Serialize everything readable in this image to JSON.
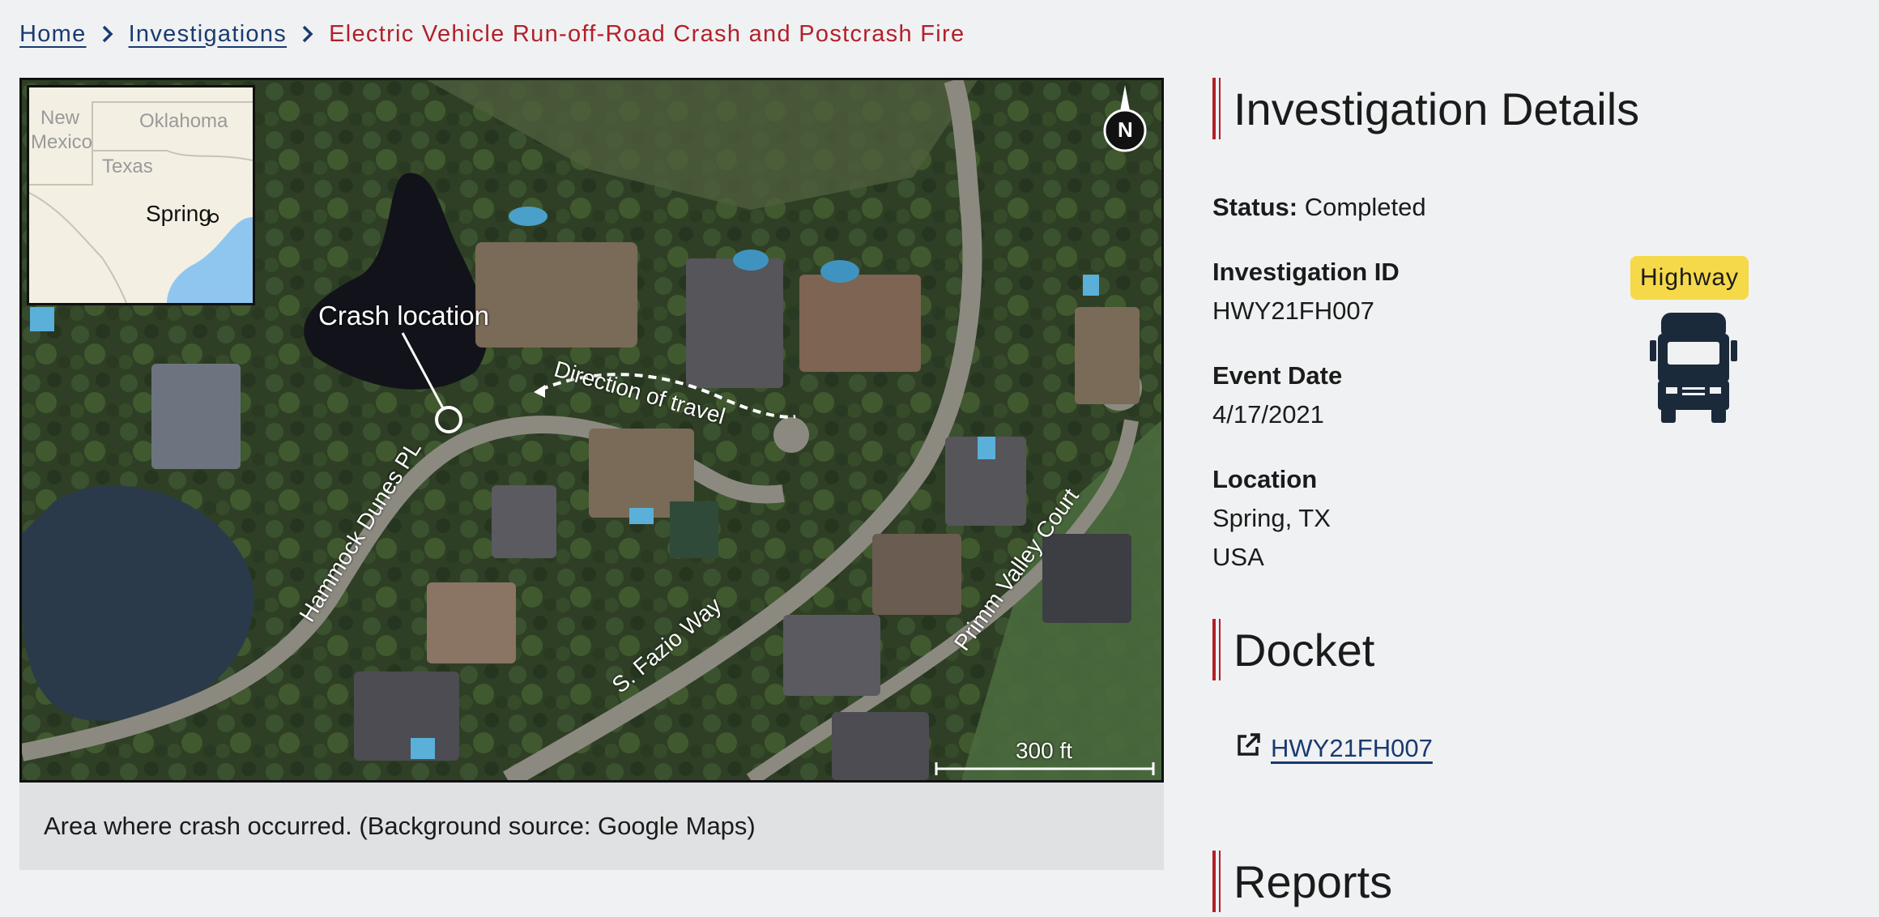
{
  "breadcrumb": {
    "home": "Home",
    "investigations": "Investigations",
    "current": "Electric Vehicle Run-off-Road Crash and Postcrash Fire"
  },
  "figure": {
    "caption": "Area where crash occurred. (Background source: Google Maps)",
    "map": {
      "crash_label": "Crash location",
      "direction_label": "Direction of travel",
      "roads": [
        "Hammock Dunes PL",
        "S. Fazio Way",
        "Primm Valley Court"
      ],
      "scale_label": "300 ft",
      "compass_label": "N",
      "inset": {
        "labels": [
          "New",
          "Mexico",
          "Oklahoma",
          "Texas"
        ],
        "city": "Spring"
      }
    }
  },
  "details": {
    "title": "Investigation Details",
    "status_label": "Status:",
    "status_value": "Completed",
    "id_label": "Investigation ID",
    "id_value": "HWY21FH007",
    "date_label": "Event Date",
    "date_value": "4/17/2021",
    "location_label": "Location",
    "location_line1": "Spring, TX",
    "location_line2": "USA",
    "mode_badge": "Highway",
    "mode_icon": "truck-icon"
  },
  "docket": {
    "title": "Docket",
    "link_text": "HWY21FH007"
  },
  "reports": {
    "title": "Reports"
  },
  "colors": {
    "accent_red": "#b2202a",
    "link_blue": "#1a3a70",
    "badge_yellow": "#f5d949"
  }
}
